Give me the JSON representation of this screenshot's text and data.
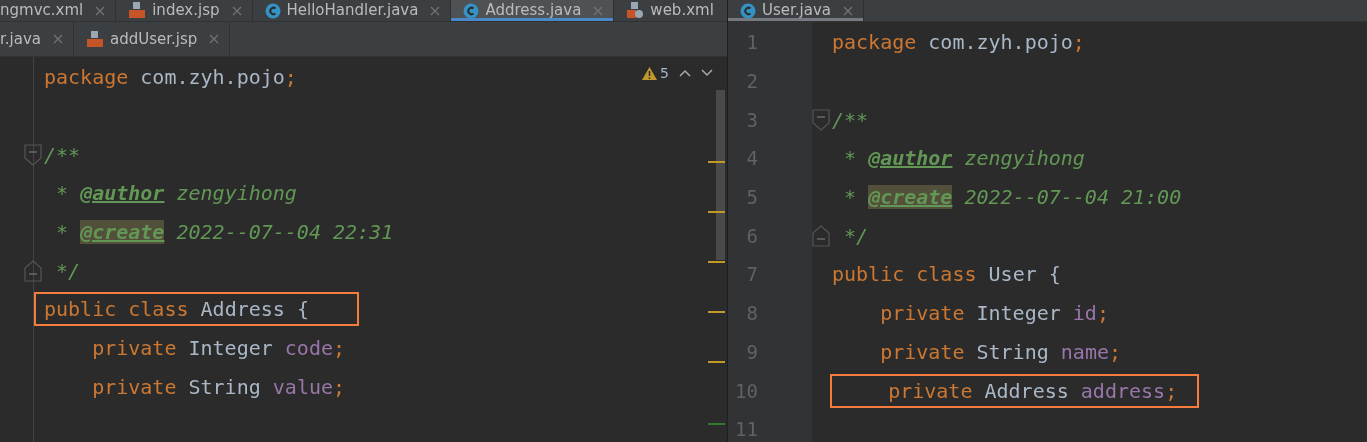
{
  "left_pane": {
    "tab_rows": [
      [
        {
          "label": "ngmvc.xml",
          "kind": "plain",
          "selected": false
        },
        {
          "label": "index.jsp",
          "kind": "jsp",
          "selected": false
        },
        {
          "label": "HelloHandler.java",
          "kind": "class",
          "selected": false
        },
        {
          "label": "Address.java",
          "kind": "class",
          "selected": true
        },
        {
          "label": "web.xml",
          "kind": "xml",
          "selected": false
        }
      ],
      [
        {
          "label": "r.java",
          "kind": "plain",
          "selected": false
        },
        {
          "label": "addUser.jsp",
          "kind": "jsp",
          "selected": false
        }
      ]
    ],
    "inspection": {
      "count": "5"
    },
    "lines": [
      {
        "kind": "code",
        "tokens": [
          {
            "text": "package ",
            "kind": "keyword"
          },
          {
            "text": "com.zyh.pojo",
            "kind": "plain"
          },
          {
            "text": ";",
            "kind": "keyword"
          }
        ]
      },
      {
        "kind": "blank"
      },
      {
        "kind": "foldstart",
        "tokens": [
          {
            "text": "/**",
            "kind": "comment"
          }
        ]
      },
      {
        "kind": "code",
        "tokens": [
          {
            "text": " * ",
            "kind": "comment"
          },
          {
            "text": "@author",
            "kind": "doctag"
          },
          {
            "text": " zengyihong",
            "kind": "comment"
          }
        ]
      },
      {
        "kind": "code",
        "tokens": [
          {
            "text": " * ",
            "kind": "comment"
          },
          {
            "text": "@create",
            "kind": "unknowntag"
          },
          {
            "text": " 2022--07--04 22:31",
            "kind": "comment"
          }
        ]
      },
      {
        "kind": "foldend",
        "tokens": [
          {
            "text": " */",
            "kind": "comment"
          }
        ]
      },
      {
        "kind": "code",
        "boxed": true,
        "tokens": [
          {
            "text": "public class ",
            "kind": "keyword"
          },
          {
            "text": "Address {",
            "kind": "plain"
          }
        ]
      },
      {
        "kind": "code",
        "tokens": [
          {
            "text": "    private ",
            "kind": "keyword"
          },
          {
            "text": "Integer ",
            "kind": "plain"
          },
          {
            "text": "code",
            "kind": "field"
          },
          {
            "text": ";",
            "kind": "keyword"
          }
        ]
      },
      {
        "kind": "code",
        "tokens": [
          {
            "text": "    private ",
            "kind": "keyword"
          },
          {
            "text": "String ",
            "kind": "plain"
          },
          {
            "text": "value",
            "kind": "field"
          },
          {
            "text": ";",
            "kind": "keyword"
          }
        ]
      }
    ]
  },
  "right_pane": {
    "tabs": [
      {
        "label": "User.java",
        "kind": "class",
        "selected": true
      }
    ],
    "lines": [
      {
        "number": "1",
        "kind": "code",
        "tokens": [
          {
            "text": "package ",
            "kind": "keyword"
          },
          {
            "text": "com.zyh.pojo",
            "kind": "plain"
          },
          {
            "text": ";",
            "kind": "keyword"
          }
        ]
      },
      {
        "number": "2",
        "kind": "blank"
      },
      {
        "number": "3",
        "kind": "foldstart",
        "tokens": [
          {
            "text": "/**",
            "kind": "comment"
          }
        ]
      },
      {
        "number": "4",
        "kind": "code",
        "tokens": [
          {
            "text": " * ",
            "kind": "comment"
          },
          {
            "text": "@author",
            "kind": "doctag"
          },
          {
            "text": " zengyihong",
            "kind": "comment"
          }
        ]
      },
      {
        "number": "5",
        "kind": "code",
        "tokens": [
          {
            "text": " * ",
            "kind": "comment"
          },
          {
            "text": "@create",
            "kind": "unknowntag"
          },
          {
            "text": " 2022--07--04 21:00",
            "kind": "comment"
          }
        ]
      },
      {
        "number": "6",
        "kind": "foldend",
        "tokens": [
          {
            "text": " */",
            "kind": "comment"
          }
        ]
      },
      {
        "number": "7",
        "kind": "code",
        "tokens": [
          {
            "text": "public class ",
            "kind": "keyword"
          },
          {
            "text": "User {",
            "kind": "plain"
          }
        ]
      },
      {
        "number": "8",
        "kind": "code",
        "tokens": [
          {
            "text": "    private ",
            "kind": "keyword"
          },
          {
            "text": "Integer ",
            "kind": "plain"
          },
          {
            "text": "id",
            "kind": "field"
          },
          {
            "text": ";",
            "kind": "keyword"
          }
        ]
      },
      {
        "number": "9",
        "kind": "code",
        "tokens": [
          {
            "text": "    private ",
            "kind": "keyword"
          },
          {
            "text": "String ",
            "kind": "plain"
          },
          {
            "text": "name",
            "kind": "field"
          },
          {
            "text": ";",
            "kind": "keyword"
          }
        ]
      },
      {
        "number": "10",
        "kind": "code",
        "boxed": true,
        "tokens": [
          {
            "text": "    private ",
            "kind": "keyword"
          },
          {
            "text": "Address ",
            "kind": "plain"
          },
          {
            "text": "address",
            "kind": "field"
          },
          {
            "text": ";",
            "kind": "keyword"
          }
        ]
      },
      {
        "number": "11",
        "kind": "blank"
      }
    ]
  }
}
